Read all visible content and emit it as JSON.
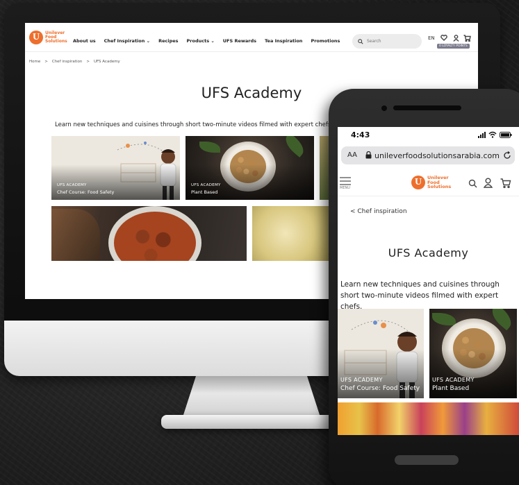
{
  "desktop": {
    "brand": {
      "line1": "Unilever",
      "line2": "Food",
      "line3": "Solutions"
    },
    "nav": [
      "About us",
      "Chef Inspiration ⌄",
      "Recipes",
      "Products ⌄",
      "UFS Rewards",
      "Tea Inspiration",
      "Promotions"
    ],
    "search_placeholder": "Search",
    "lang": "EN",
    "loyalty": "0 LOYALTY POINTS",
    "breadcrumbs": [
      "Home",
      ">",
      "Chef inspiration",
      ">",
      "UFS Academy"
    ],
    "title": "UFS Academy",
    "description": "Learn new techniques and cuisines through short two-minute videos filmed with expert chefs.",
    "cards": [
      {
        "kicker": "UFS ACADEMY",
        "title": "Chef Course: Food Safety"
      },
      {
        "kicker": "UFS ACADEMY",
        "title": "Plant Based"
      }
    ]
  },
  "mobile": {
    "time": "4:43",
    "aa": "AA",
    "url": "unileverfoodsolutionsarabia.com",
    "menu": "MENU",
    "brand": {
      "line1": "Unilever",
      "line2": "Food",
      "line3": "Solutions"
    },
    "back": "<  Chef inspiration",
    "title": "UFS Academy",
    "description": "Learn new techniques and cuisines through short two-minute videos filmed with expert chefs.",
    "cards": [
      {
        "kicker": "UFS ACADEMY",
        "title": "Chef Course: Food Safety"
      },
      {
        "kicker": "UFS ACADEMY",
        "title": "Plant Based"
      }
    ]
  },
  "colors": {
    "brand": "#ee6f2d",
    "card_illustration_bg": "#ece8df"
  },
  "icons": [
    "search-icon",
    "heart-icon",
    "user-icon",
    "cart-icon",
    "hamburger-icon",
    "lock-icon",
    "reload-icon",
    "signal-icon",
    "wifi-icon",
    "battery-icon"
  ]
}
